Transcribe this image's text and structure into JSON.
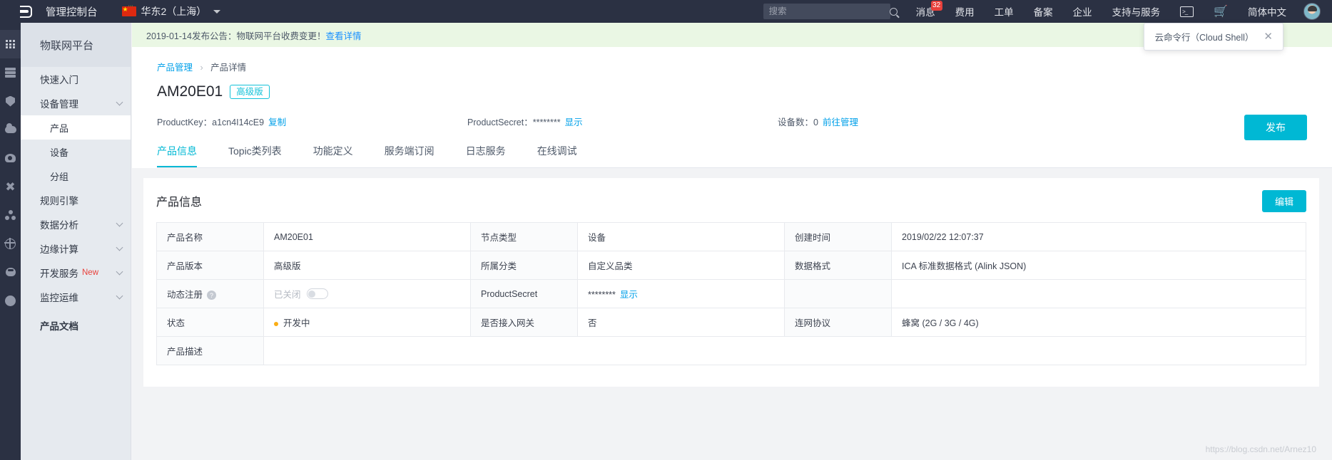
{
  "topbar": {
    "logo_icon": "aliyun-logo-icon",
    "console_title": "管理控制台",
    "region": "华东2（上海）",
    "search_placeholder": "搜索",
    "search_value": "",
    "search_icon": "search-icon",
    "nav": [
      {
        "label": "消息",
        "badge": "32"
      },
      {
        "label": "费用",
        "badge": ""
      },
      {
        "label": "工单",
        "badge": ""
      },
      {
        "label": "备案",
        "badge": ""
      },
      {
        "label": "企业",
        "badge": ""
      },
      {
        "label": "支持与服务",
        "badge": ""
      }
    ],
    "shell_icon": "terminal-icon",
    "cart_icon": "shopping-cart-icon",
    "language": "简体中文",
    "avatar": "user-avatar"
  },
  "rail": [
    {
      "icon": "apps-grid-icon",
      "active": true
    },
    {
      "icon": "server-stack-icon",
      "active": false
    },
    {
      "icon": "shield-icon",
      "active": false
    },
    {
      "icon": "cloud-icon",
      "active": false
    },
    {
      "icon": "database-icon",
      "active": false
    },
    {
      "icon": "network-cross-icon",
      "active": false
    },
    {
      "icon": "nodes-icon",
      "active": false
    },
    {
      "icon": "globe-icon",
      "active": false
    },
    {
      "icon": "bug-icon",
      "active": false
    },
    {
      "icon": "circle-icon",
      "active": false
    }
  ],
  "sidebar": {
    "header": "物联网平台",
    "items": [
      {
        "label": "快速入门",
        "type": "top",
        "chevron": false,
        "active": false
      },
      {
        "label": "设备管理",
        "type": "top",
        "chevron": true,
        "active": false
      },
      {
        "label": "产品",
        "type": "sub",
        "chevron": false,
        "active": true
      },
      {
        "label": "设备",
        "type": "sub",
        "chevron": false,
        "active": false
      },
      {
        "label": "分组",
        "type": "sub",
        "chevron": false,
        "active": false
      },
      {
        "label": "规则引擎",
        "type": "top",
        "chevron": false,
        "active": false
      },
      {
        "label": "数据分析",
        "type": "top",
        "chevron": true,
        "active": false
      },
      {
        "label": "边缘计算",
        "type": "top",
        "chevron": true,
        "active": false
      },
      {
        "label": "开发服务",
        "type": "top",
        "chevron": true,
        "active": false,
        "tag": "New"
      },
      {
        "label": "监控运维",
        "type": "top",
        "chevron": true,
        "active": false
      },
      {
        "label": "产品文档",
        "type": "top",
        "chevron": false,
        "active": false,
        "bold": true
      }
    ]
  },
  "notice": {
    "text": "2019-01-14发布公告：物联网平台收费变更！",
    "link": "查看详情",
    "close_icon": "close-icon"
  },
  "breadcrumb": {
    "parent": "产品管理",
    "separator": "›",
    "current": "产品详情"
  },
  "header": {
    "product_name": "AM20E01",
    "version_badge": "高级版",
    "publish_button": "发布",
    "product_key_label": "ProductKey：",
    "product_key_value": "a1cn4I14cE9",
    "copy_link": "复制",
    "product_secret_label": "ProductSecret：",
    "product_secret_value": "********",
    "show_link": "显示",
    "device_count_label": "设备数：0",
    "manage_link": "前往管理"
  },
  "tabs": [
    {
      "label": "产品信息",
      "active": true
    },
    {
      "label": "Topic类列表",
      "active": false
    },
    {
      "label": "功能定义",
      "active": false
    },
    {
      "label": "服务端订阅",
      "active": false
    },
    {
      "label": "日志服务",
      "active": false
    },
    {
      "label": "在线调试",
      "active": false
    }
  ],
  "panel": {
    "title": "产品信息",
    "edit_button": "编辑",
    "rows": [
      {
        "l1": "产品名称",
        "v1": "AM20E01",
        "l2": "节点类型",
        "v2": "设备",
        "l3": "创建时间",
        "v3": "2019/02/22 12:07:37"
      },
      {
        "l1": "产品版本",
        "v1": "高级版",
        "l2": "所属分类",
        "v2": "自定义品类",
        "l3": "数据格式",
        "v3": "ICA 标准数据格式 (Alink JSON)"
      },
      {
        "l1": "动态注册",
        "v1": "已关闭",
        "l2": "ProductSecret",
        "v2": "********",
        "l2_link": "显示",
        "l3": "",
        "v3": ""
      },
      {
        "l1": "状态",
        "v1": "开发中",
        "l2": "是否接入网关",
        "v2": "否",
        "l3": "连网协议",
        "v3": "蜂窝 (2G / 3G / 4G)"
      },
      {
        "l1": "产品描述",
        "v1": "",
        "l2": "",
        "v2": "",
        "l3": "",
        "v3": ""
      }
    ],
    "help_icon": "help-circle-icon",
    "switch_state": "off"
  },
  "shell_popup": {
    "text": "云命令行（Cloud Shell）",
    "close_icon": "close-icon"
  },
  "watermark": "https://blog.csdn.net/Arnez10",
  "colors": {
    "accent": "#00b8d4",
    "link": "#00a0e9",
    "topbar_bg": "#2b3143",
    "sidebar_bg": "#e6eaef",
    "notice_bg": "#eaf7e4",
    "badge_red": "#e8413c",
    "status_orange": "#faad14"
  }
}
